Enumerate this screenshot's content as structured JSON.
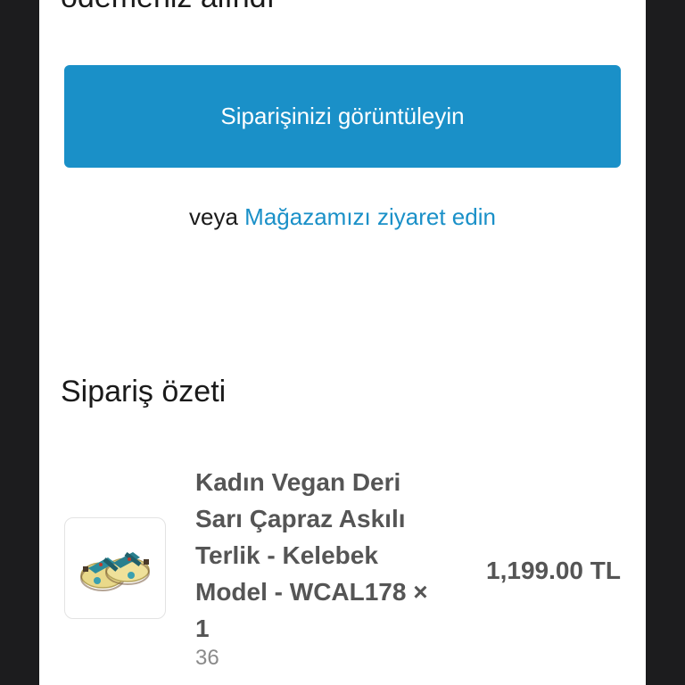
{
  "page": {
    "heading_partial": "ödemeniz alındı"
  },
  "colors": {
    "accent": "#1a90c8",
    "link": "#1a90c8",
    "text": "#1a1a1a",
    "muted": "#8a8a8a",
    "frame": "#1c1c1e"
  },
  "actions": {
    "view_order_label": "Siparişinizi görüntüleyin",
    "or_text": "veya",
    "visit_store_label": "Mağazamızı ziyaret edin"
  },
  "summary": {
    "title": "Sipariş özeti",
    "items": [
      {
        "image_icon": "sandal-product-image",
        "name": "Kadın Vegan Deri Sarı Çapraz Askılı Terlik - Kelebek Model - WCAL178",
        "quantity_text": "× 1",
        "variant": "36",
        "price": "1,199.00 TL"
      }
    ]
  }
}
